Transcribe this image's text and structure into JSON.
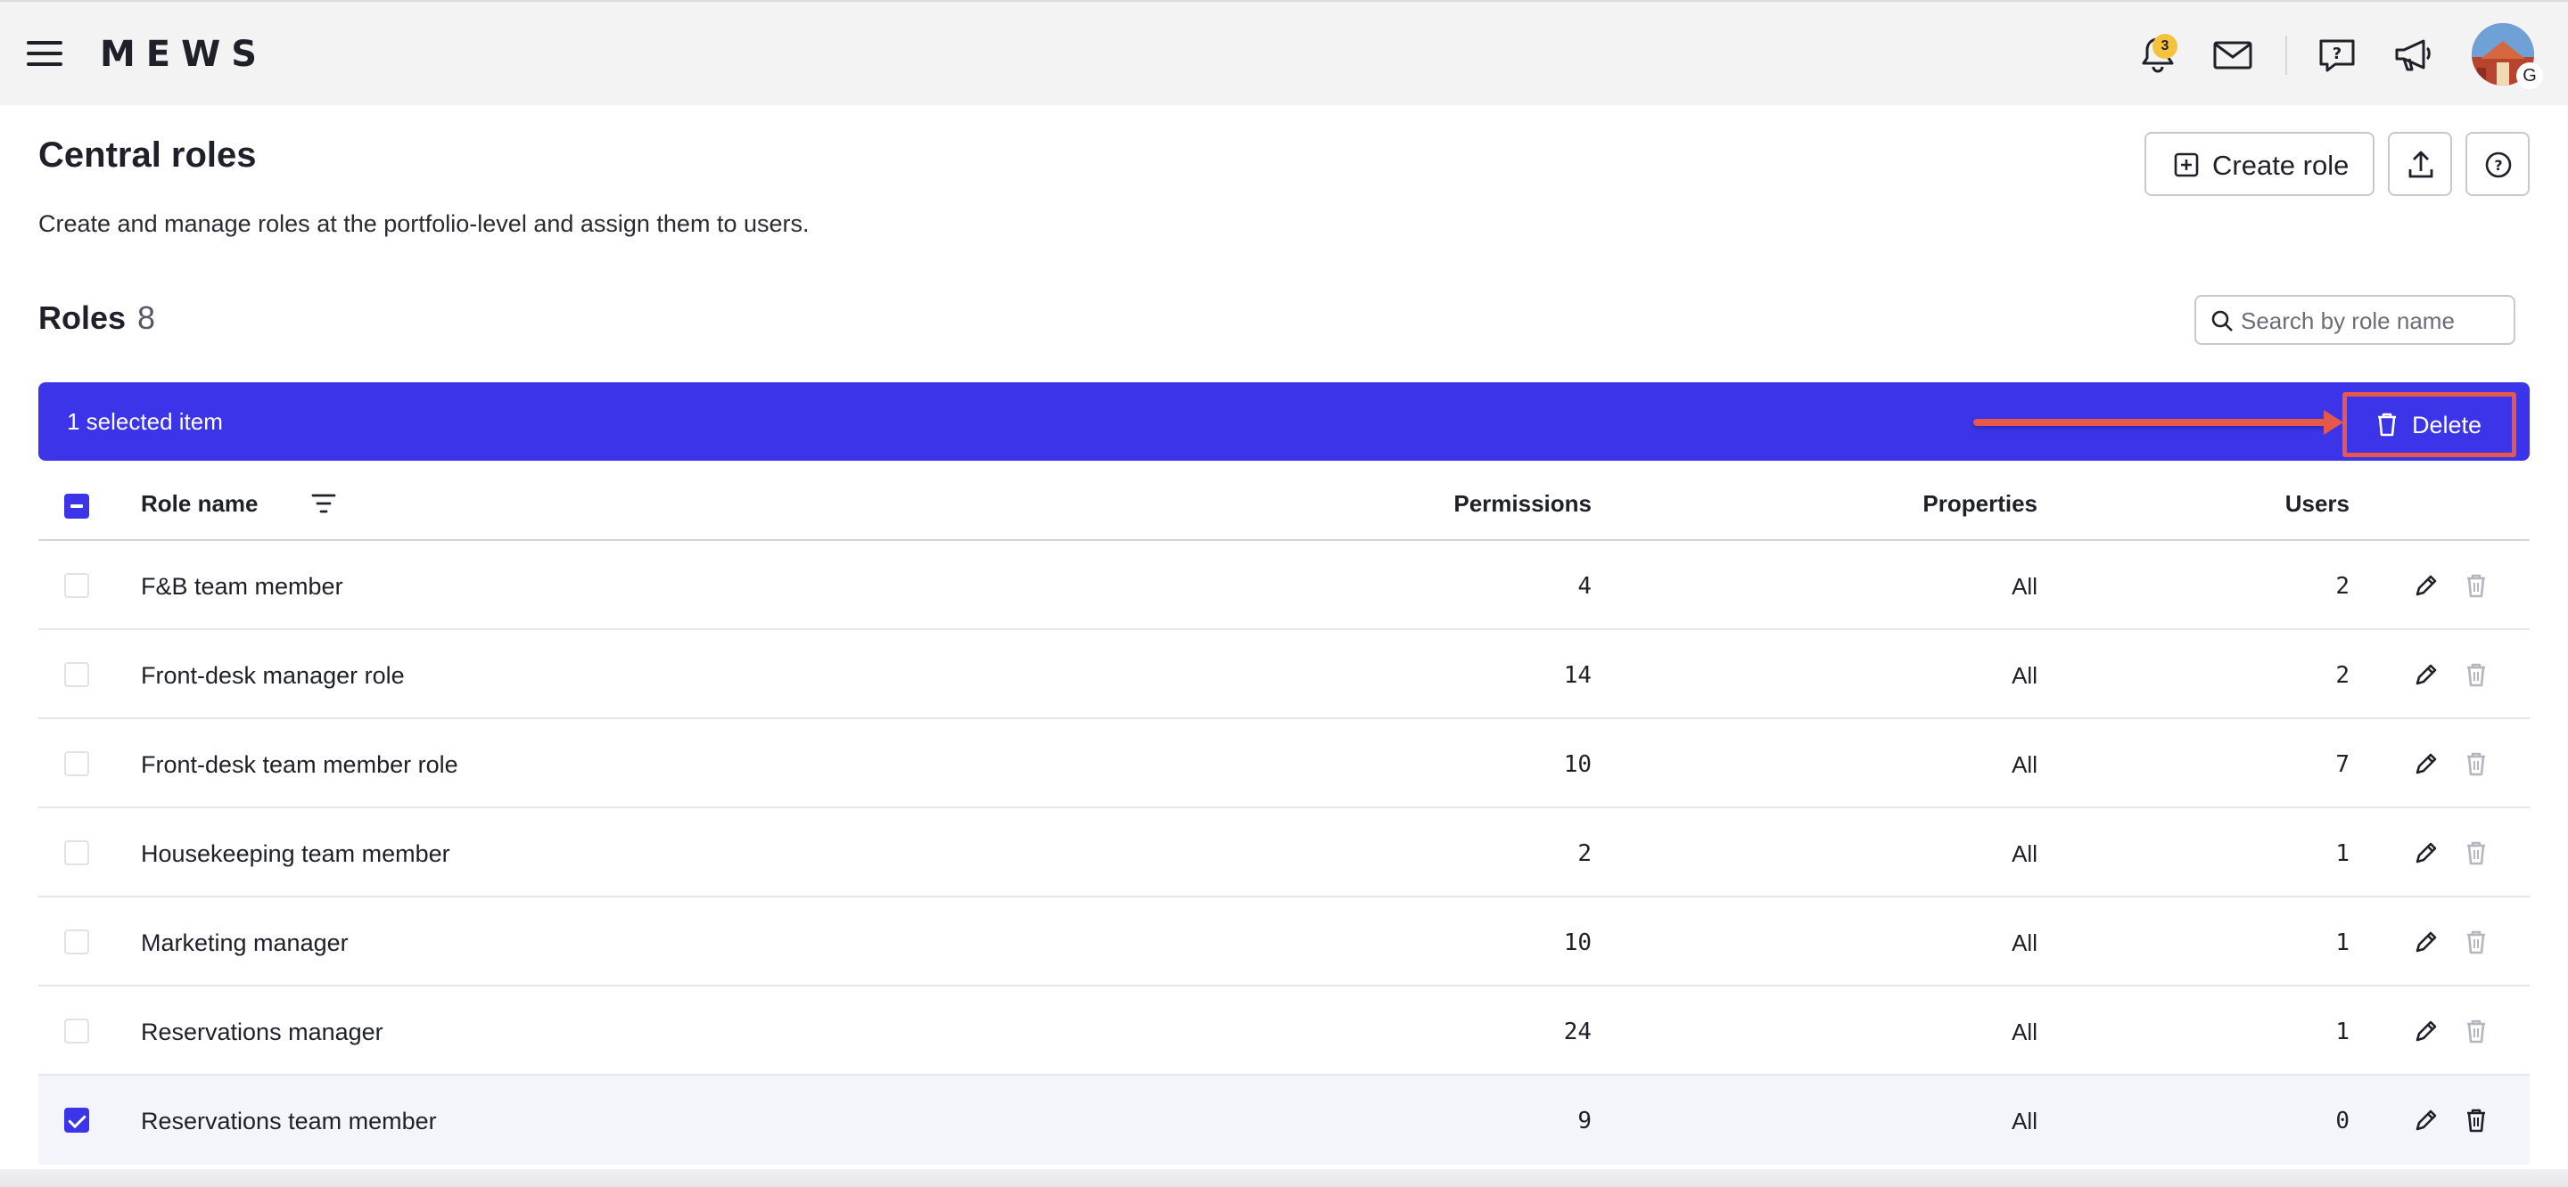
{
  "app": {
    "logo": "MEWS"
  },
  "topbar": {
    "notifications_count": "3",
    "avatar_initial": "G",
    "icons": [
      "menu-icon",
      "bell-icon",
      "mail-icon",
      "help-chat-icon",
      "megaphone-icon"
    ]
  },
  "page": {
    "title": "Central roles",
    "subtitle": "Create and manage roles at the portfolio-level and assign them to users.",
    "create_label": "Create role"
  },
  "roles": {
    "title": "Roles",
    "count": "8",
    "search_placeholder": "Search by role name"
  },
  "selection": {
    "text": "1 selected item",
    "delete_label": "Delete",
    "highlight_color": "#e5584a",
    "bar_color": "#3b34e8"
  },
  "table": {
    "headers": {
      "name": "Role name",
      "permissions": "Permissions",
      "properties": "Properties",
      "users": "Users"
    },
    "rows": [
      {
        "name": "F&B team member",
        "permissions": "4",
        "properties": "All",
        "users": "2",
        "checked": false
      },
      {
        "name": "Front-desk manager role",
        "permissions": "14",
        "properties": "All",
        "users": "2",
        "checked": false
      },
      {
        "name": "Front-desk team member role",
        "permissions": "10",
        "properties": "All",
        "users": "7",
        "checked": false
      },
      {
        "name": "Housekeeping team member",
        "permissions": "2",
        "properties": "All",
        "users": "1",
        "checked": false
      },
      {
        "name": "Marketing manager",
        "permissions": "10",
        "properties": "All",
        "users": "1",
        "checked": false
      },
      {
        "name": "Reservations manager",
        "permissions": "24",
        "properties": "All",
        "users": "1",
        "checked": false
      },
      {
        "name": "Reservations team member",
        "permissions": "9",
        "properties": "All",
        "users": "0",
        "checked": true
      }
    ]
  }
}
